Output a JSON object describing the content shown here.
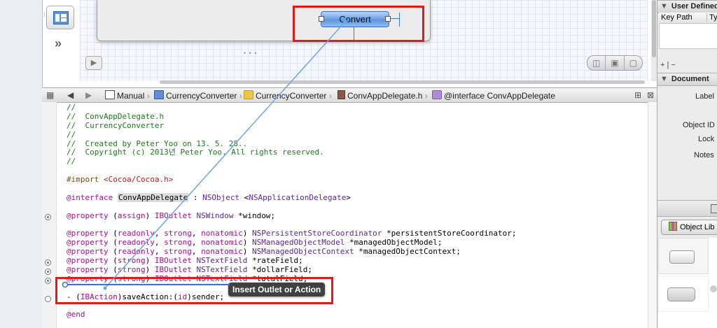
{
  "canvas": {
    "convert_label": "Convert",
    "zoom_buttons": [
      "◫",
      "▣",
      "▢"
    ]
  },
  "jumpbar": {
    "crumbs": [
      "Manual",
      "CurrencyConverter",
      "CurrencyConverter",
      "ConvAppDelegate.h",
      "@interface ConvAppDelegate"
    ]
  },
  "code": {
    "lines": [
      "//",
      "//  ConvAppDelegate.h",
      "//  CurrencyConverter",
      "//",
      "//  Created by Peter Yoo on 13. 5. 28..",
      "//  Copyright (c) 2013년 Peter Yoo. All rights reserved.",
      "//",
      "",
      "#import <Cocoa/Cocoa.h>",
      "",
      "@interface ConvAppDelegate : NSObject <NSApplicationDelegate>",
      "",
      "@property (assign) IBOutlet NSWindow *window;",
      "",
      "@property (readonly, strong, nonatomic) NSPersistentStoreCoordinator *persistentStoreCoordinator;",
      "@property (readonly, strong, nonatomic) NSManagedObjectModel *managedObjectModel;",
      "@property (readonly, strong, nonatomic) NSManagedObjectContext *managedObjectContext;",
      "@property (strong) IBOutlet NSTextField *rateField;",
      "@property (strong) IBOutlet NSTextField *dollarField;",
      "@property (strong) IBOutlet NSTextField *totalField;",
      "",
      "- (IBAction)saveAction:(id)sender;",
      "",
      "@end"
    ],
    "tooltip": "Insert Outlet or Action"
  },
  "inspector": {
    "user_defined_title": "User Defined",
    "key_path_header": "Key Path",
    "type_header": "Ty",
    "add_remove": "+ | −",
    "document_title": "Document",
    "label_label": "Label",
    "object_id_label": "Object ID",
    "lock_label": "Lock",
    "notes_label": "Notes",
    "library_label": "Object Lib"
  }
}
